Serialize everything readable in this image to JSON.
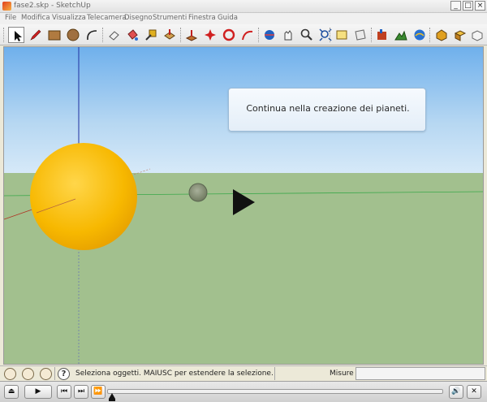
{
  "window": {
    "title": "fase2.skp - SketchUp"
  },
  "menu": {
    "items": [
      "File",
      "Modifica",
      "Visualizza",
      "Telecamera",
      "Disegno",
      "Strumenti",
      "Finestra",
      "Guida"
    ]
  },
  "window_controls": {
    "minimize": "_",
    "maximize": "□",
    "close": "×"
  },
  "toolbar": {
    "tools": [
      "select-icon",
      "pencil-line-icon",
      "rectangle-icon",
      "circle-icon",
      "arc-icon",
      "eraser-icon",
      "paint-bucket-icon",
      "tape-measure-icon",
      "push-pull-icon",
      "move-icon",
      "rotate-icon",
      "follow-me-icon",
      "orbit-icon",
      "pan-icon",
      "zoom-icon",
      "zoom-extents-icon",
      "text-icon",
      "section-icon",
      "add-location-icon",
      "get-models-icon",
      "components-icon",
      "share-model-icon"
    ]
  },
  "scene": {
    "message": "Continua nella creazione dei pianeti."
  },
  "status": {
    "help_glyph": "?",
    "text": "Seleziona oggetti. MAIUSC per estendere la selezione. Tr",
    "measure_label": "Misure",
    "measure_value": ""
  },
  "player": {
    "exit_glyph": "⏏",
    "play_glyph": "▶",
    "prev_glyph": "⏮",
    "next_glyph": "⏭",
    "fast_forward_glyph": "⏩",
    "volume_glyph": "🔊",
    "close_glyph": "✕",
    "progress": 0.0
  },
  "colors": {
    "sun": "#f5b800",
    "sky_top": "#6fb0ec",
    "ground": "#a2c08e"
  }
}
